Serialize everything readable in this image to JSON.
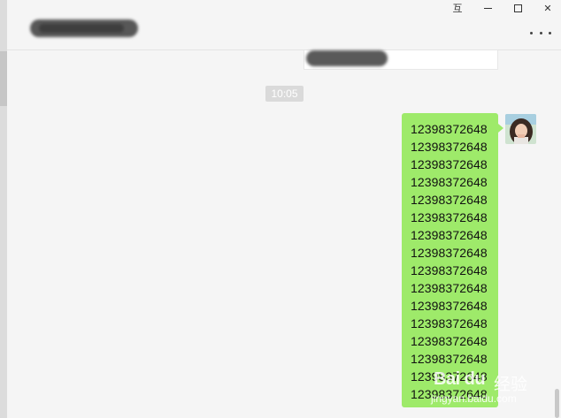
{
  "window": {
    "pin_glyph": "互",
    "close_glyph": "✕"
  },
  "header": {
    "chat_title": "",
    "more_icon": "more-dots-icon"
  },
  "quoted_message": {
    "text": ""
  },
  "timestamp": "10:05",
  "message": {
    "lines": [
      "12398372648",
      "12398372648",
      "12398372648",
      "12398372648",
      "12398372648",
      "12398372648",
      "12398372648",
      "12398372648",
      "12398372648",
      "12398372648",
      "12398372648",
      "12398372648",
      "12398372648",
      "12398372648",
      "12398372648",
      "12398372648"
    ],
    "bubble_color": "#9eea6a"
  },
  "watermark": {
    "brand": "Bai du",
    "cn": "经验",
    "url": "jingyan.baidu.com"
  },
  "colors": {
    "background": "#f5f5f5",
    "timestamp_chip": "#dadada"
  }
}
